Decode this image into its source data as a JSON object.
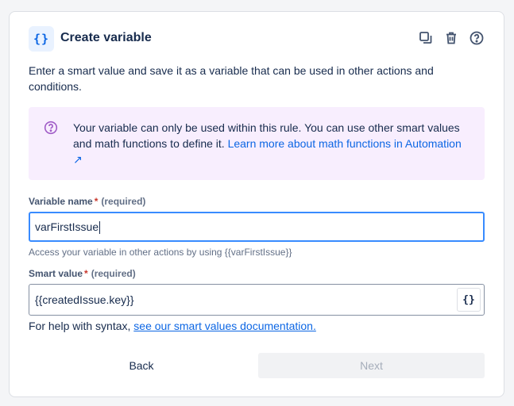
{
  "header": {
    "badge_text": "{}",
    "title": "Create variable",
    "icons": [
      "duplicate-icon",
      "trash-icon",
      "help-icon"
    ]
  },
  "description": "Enter a smart value and save it as a variable that can be used in other actions and conditions.",
  "info": {
    "text": "Your variable can only be used within this rule. You can use other smart values and math functions to define it. ",
    "link": "Learn more about math functions in Automation ↗"
  },
  "variable_name": {
    "label": "Variable name",
    "required_mark": "*",
    "required_text": "(required)",
    "value": "varFirstIssue",
    "help": "Access your variable in other actions by using {{varFirstIssue}}"
  },
  "smart_value": {
    "label": "Smart value",
    "required_mark": "*",
    "required_text": "(required)",
    "value": "{{createdIssue.key}}",
    "button_text": "{}"
  },
  "syntax_help": {
    "text": "For help with syntax, ",
    "link": "see our smart values documentation."
  },
  "buttons": {
    "back": "Back",
    "next": "Next"
  },
  "colors": {
    "accent": "#0c66e4",
    "info_bg": "#f8eefe",
    "info_icon": "#a05cc7",
    "required": "#c9372c",
    "focus_border": "#388bff"
  }
}
